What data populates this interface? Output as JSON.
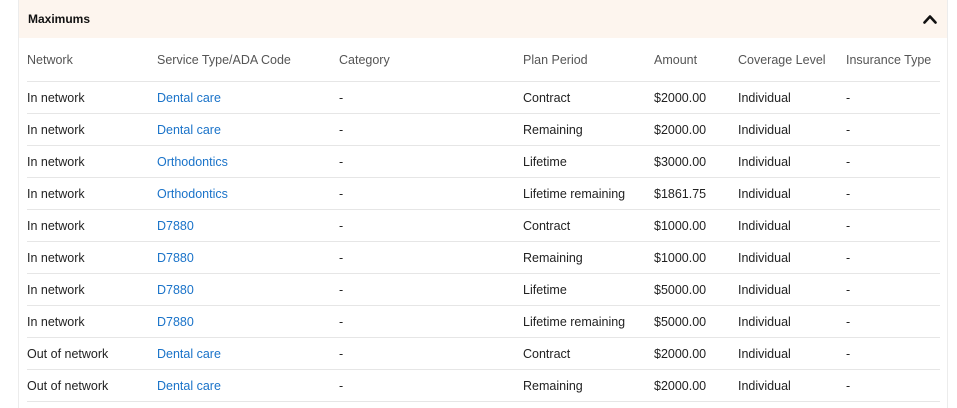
{
  "section": {
    "title": "Maximums",
    "toggle_icon": "chevron-up-icon"
  },
  "columns": [
    "Network",
    "Service Type/ADA Code",
    "Category",
    "Plan Period",
    "Amount",
    "Coverage Level",
    "Insurance Type"
  ],
  "rows": [
    {
      "network": "In network",
      "service": "Dental care",
      "category": "-",
      "period": "Contract",
      "amount": "$2000.00",
      "coverage": "Individual",
      "insurance": "-"
    },
    {
      "network": "In network",
      "service": "Dental care",
      "category": "-",
      "period": "Remaining",
      "amount": "$2000.00",
      "coverage": "Individual",
      "insurance": "-"
    },
    {
      "network": "In network",
      "service": "Orthodontics",
      "category": "-",
      "period": "Lifetime",
      "amount": "$3000.00",
      "coverage": "Individual",
      "insurance": "-"
    },
    {
      "network": "In network",
      "service": "Orthodontics",
      "category": "-",
      "period": "Lifetime remaining",
      "amount": "$1861.75",
      "coverage": "Individual",
      "insurance": "-"
    },
    {
      "network": "In network",
      "service": "D7880",
      "category": "-",
      "period": "Contract",
      "amount": "$1000.00",
      "coverage": "Individual",
      "insurance": "-"
    },
    {
      "network": "In network",
      "service": "D7880",
      "category": "-",
      "period": "Remaining",
      "amount": "$1000.00",
      "coverage": "Individual",
      "insurance": "-"
    },
    {
      "network": "In network",
      "service": "D7880",
      "category": "-",
      "period": "Lifetime",
      "amount": "$5000.00",
      "coverage": "Individual",
      "insurance": "-"
    },
    {
      "network": "In network",
      "service": "D7880",
      "category": "-",
      "period": "Lifetime remaining",
      "amount": "$5000.00",
      "coverage": "Individual",
      "insurance": "-"
    },
    {
      "network": "Out of network",
      "service": "Dental care",
      "category": "-",
      "period": "Contract",
      "amount": "$2000.00",
      "coverage": "Individual",
      "insurance": "-"
    },
    {
      "network": "Out of network",
      "service": "Dental care",
      "category": "-",
      "period": "Remaining",
      "amount": "$2000.00",
      "coverage": "Individual",
      "insurance": "-"
    }
  ],
  "colors": {
    "header_bg": "#fdf5ee",
    "link": "#1a73c9",
    "divider": "#e6e6e6"
  }
}
